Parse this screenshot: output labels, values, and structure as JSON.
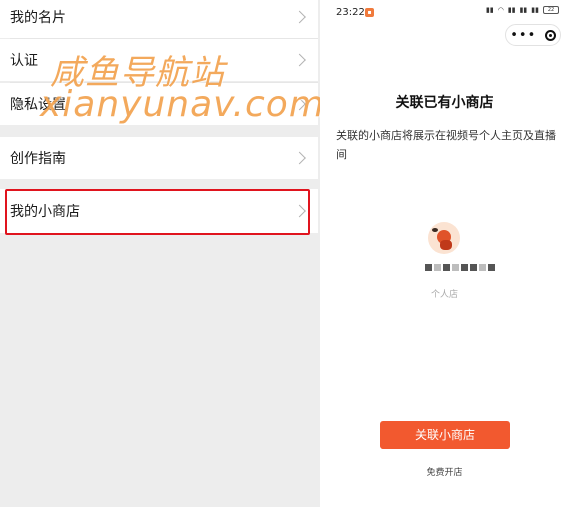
{
  "left_panel": {
    "rows": [
      {
        "label": "我的名片"
      },
      {
        "label": "认证"
      },
      {
        "label": "隐私设置"
      },
      {
        "label": "创作指南"
      },
      {
        "label": "我的小商店"
      }
    ]
  },
  "watermark": {
    "line1": "咸鱼导航站",
    "line2": "xianyunav.com"
  },
  "right_panel": {
    "status_bar": {
      "time": "23:22",
      "battery": "22"
    },
    "title": "关联已有小商店",
    "description": "关联的小商店将展示在视频号个人主页及直播间",
    "shop_type": "个人店",
    "link_button": "关联小商店",
    "free_open": "免费开店"
  },
  "colors": {
    "highlight_border": "#e0141e",
    "primary_button": "#f2592f",
    "watermark": "#f2a24f"
  }
}
